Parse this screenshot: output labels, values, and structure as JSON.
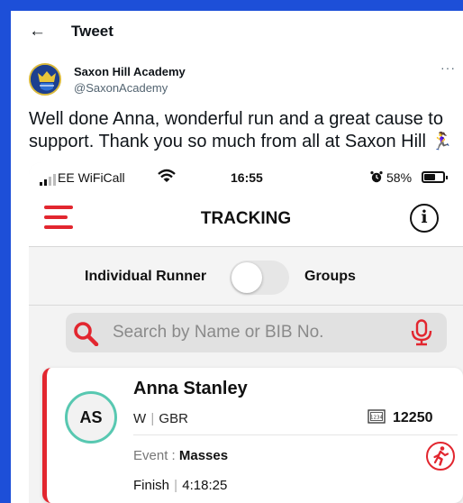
{
  "colors": {
    "page_border": "#1d4fd8",
    "accent_red": "#e2262f",
    "avatar_ring": "#58c8b1"
  },
  "tweet": {
    "back_icon": "arrow-left-icon",
    "title": "Tweet",
    "account_name": "Saxon Hill Academy",
    "account_handle": "@SaxonAcademy",
    "more_label": "···",
    "text": "Well done Anna, wonderful run and a great cause to support. Thank you so much from all at Saxon Hill",
    "emoji": "🏃‍♀️"
  },
  "phone": {
    "status": {
      "carrier": "EE WiFiCall",
      "time": "16:55",
      "battery": "58%",
      "icons": [
        "signal-icon",
        "wifi-icon",
        "alarm-icon",
        "battery-icon"
      ]
    },
    "app_bar": {
      "title": "TRACKING",
      "menu_icon": "hamburger-menu-icon",
      "info_icon": "info-icon",
      "info_glyph": "i"
    },
    "toggle": {
      "left_label": "Individual Runner",
      "right_label": "Groups",
      "state": "individual"
    },
    "search": {
      "placeholder": "Search by Name or BIB No.",
      "value": ""
    },
    "runner": {
      "initials": "AS",
      "name": "Anna Stanley",
      "gender": "W",
      "country": "GBR",
      "bib_icon_label": "1234",
      "bib": "12250",
      "event_label": "Event : ",
      "event": "Masses",
      "finish_label": "Finish",
      "finish_time": "4:18:25"
    }
  }
}
